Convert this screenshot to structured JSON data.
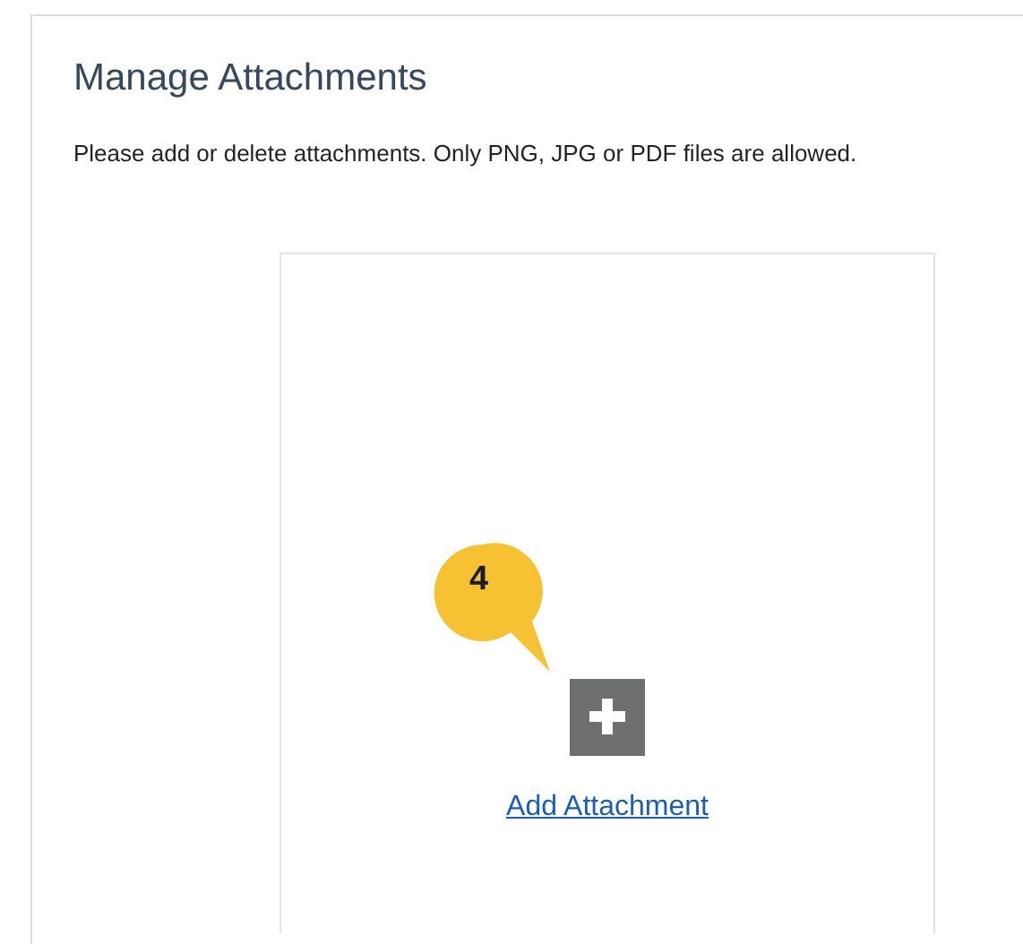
{
  "panel": {
    "title": "Manage Attachments",
    "description": "Please add or delete attachments. Only PNG, JPG or PDF files are allowed."
  },
  "callout": {
    "number": "4"
  },
  "attachment": {
    "link": "Add Attachment"
  }
}
